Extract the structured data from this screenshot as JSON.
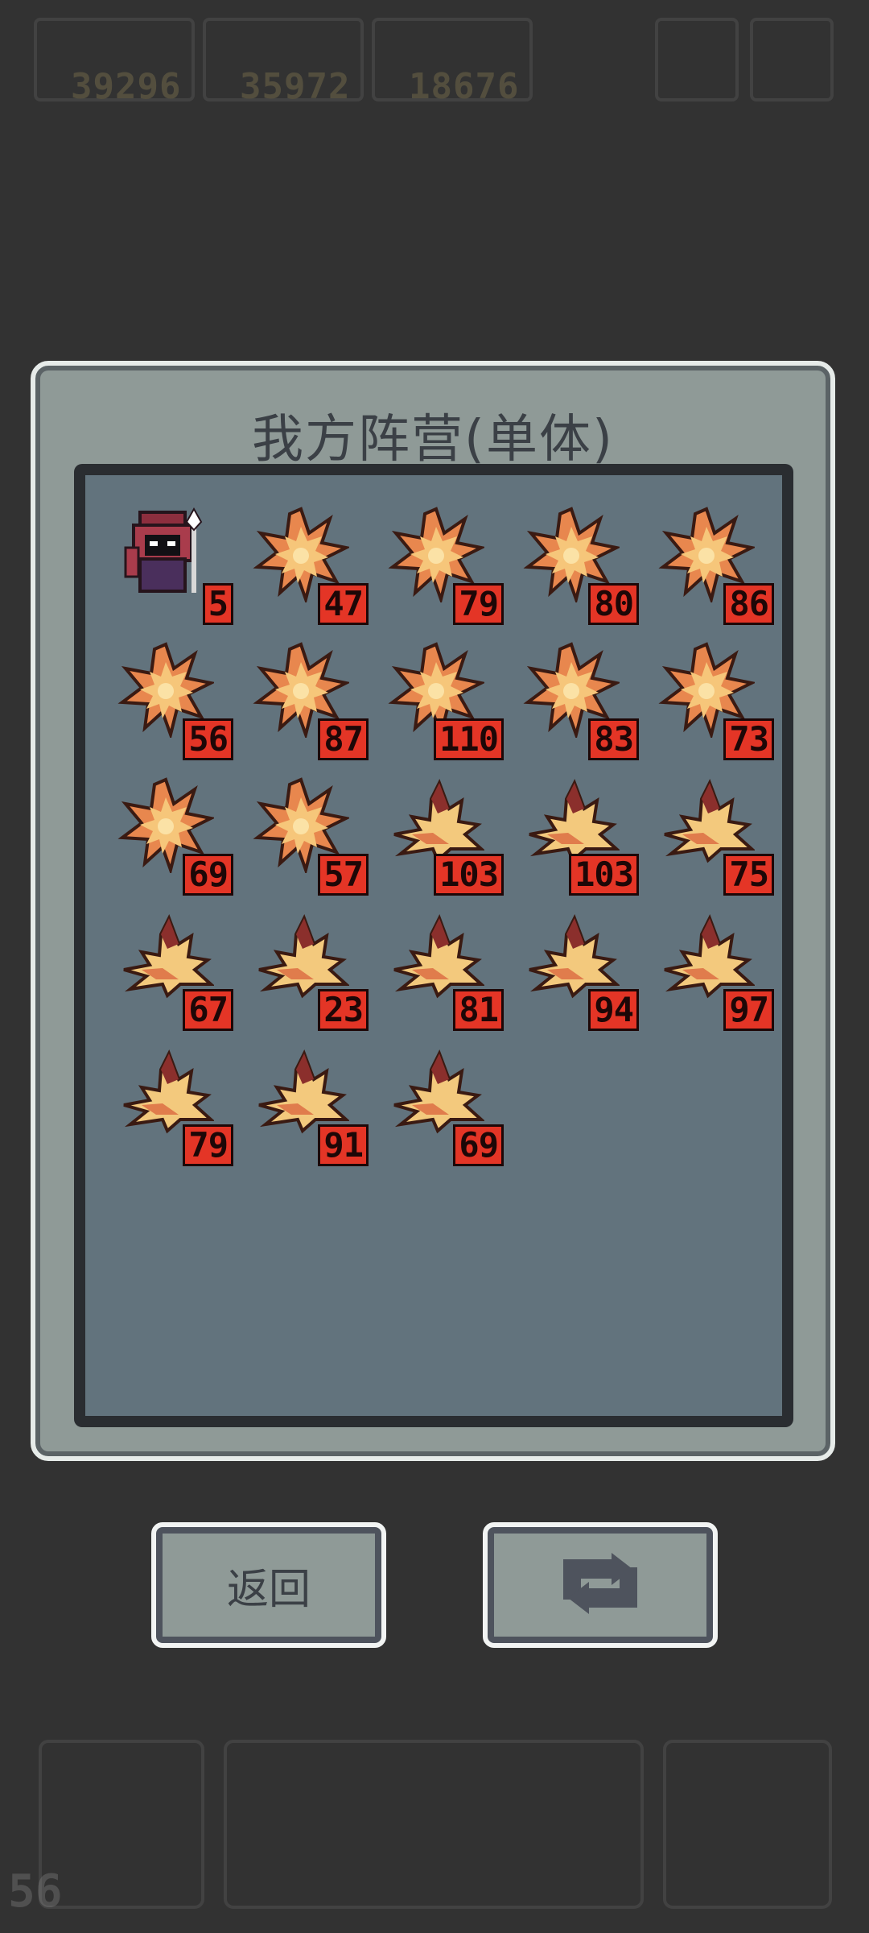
{
  "hud": {
    "resources": [
      "39296",
      "35972",
      "18676"
    ],
    "bottom_counter": "56"
  },
  "panel": {
    "title": "我方阵营(单体)"
  },
  "units": [
    {
      "kind": "mage",
      "level": "5"
    },
    {
      "kind": "star",
      "level": "47"
    },
    {
      "kind": "star",
      "level": "79"
    },
    {
      "kind": "star",
      "level": "80"
    },
    {
      "kind": "star",
      "level": "86"
    },
    {
      "kind": "star",
      "level": "56"
    },
    {
      "kind": "star",
      "level": "87"
    },
    {
      "kind": "star",
      "level": "110"
    },
    {
      "kind": "star",
      "level": "83"
    },
    {
      "kind": "star",
      "level": "73"
    },
    {
      "kind": "star",
      "level": "69"
    },
    {
      "kind": "star",
      "level": "57"
    },
    {
      "kind": "wing",
      "level": "103"
    },
    {
      "kind": "wing",
      "level": "103"
    },
    {
      "kind": "wing",
      "level": "75"
    },
    {
      "kind": "wing",
      "level": "67"
    },
    {
      "kind": "wing",
      "level": "23"
    },
    {
      "kind": "wing",
      "level": "81"
    },
    {
      "kind": "wing",
      "level": "94"
    },
    {
      "kind": "wing",
      "level": "97"
    },
    {
      "kind": "wing",
      "level": "79"
    },
    {
      "kind": "wing",
      "level": "91"
    },
    {
      "kind": "wing",
      "level": "69"
    }
  ],
  "buttons": {
    "back_label": "返回",
    "refresh_icon": "refresh-icon"
  },
  "colors": {
    "level_badge": "#e43526",
    "panel": "#8f9a97",
    "inner": "#62737d"
  }
}
